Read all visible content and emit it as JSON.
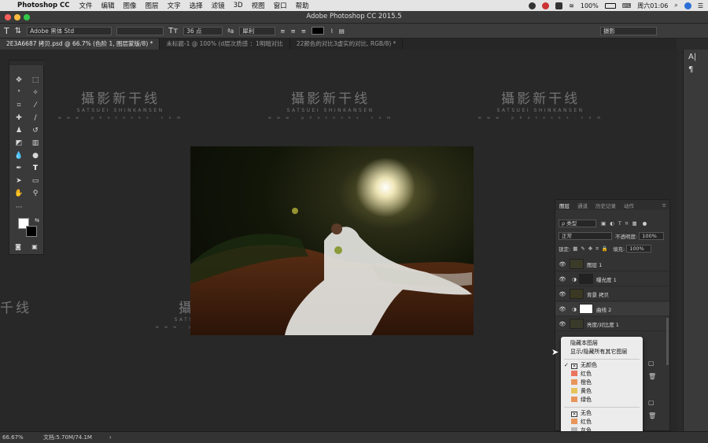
{
  "menubar": {
    "app": "Photoshop CC",
    "items": [
      "文件",
      "编辑",
      "图像",
      "图层",
      "文字",
      "选择",
      "滤镜",
      "3D",
      "视图",
      "窗口",
      "帮助"
    ],
    "battery": "100%",
    "clock": "周六01:06"
  },
  "window": {
    "title": "Adobe Photoshop CC 2015.5"
  },
  "options": {
    "font_family": "Adobe 黑体 Std",
    "font_size": "36 点",
    "antialias": "犀利",
    "workspace": "摄影"
  },
  "tabs": [
    {
      "label": "2E3A6687 拷贝.psd @ 66.7% (色阶 1, 图层蒙版/8) *"
    },
    {
      "label": "未标题-1 @ 100% (d层次质感 ：1明暗对比"
    },
    {
      "label": "22颜色的对比3虚实的对比, RGB/8) *"
    }
  ],
  "watermark": {
    "title": "攝影新干线",
    "subtitle": "SATSUEI SHINKANSEN",
    "url": "w w w . p h o t o s k s . c o m",
    "short_title": "千线"
  },
  "right_column": {
    "char_icon": "A|",
    "para_icon": "¶"
  },
  "layers_panel": {
    "tabs": [
      "图层",
      "通道",
      "历史记录",
      "动作"
    ],
    "kind_filter": "ρ 类型",
    "blend_mode": "正常",
    "opacity_label": "不透明度:",
    "opacity_value": "100%",
    "lock_label": "锁定:",
    "fill_label": "填充:",
    "fill_value": "100%",
    "layers": [
      {
        "name": "图层 1"
      },
      {
        "name": "曝光度 1"
      },
      {
        "name": "背景 拷贝"
      },
      {
        "name": "曲线 2"
      },
      {
        "name": "亮度/对比度 1"
      }
    ]
  },
  "context_menu": {
    "items": [
      "隐藏本图层",
      "显示/隐藏所有其它图层"
    ],
    "colors": [
      {
        "label": "无颜色",
        "hex": "#ffffff",
        "checked": true
      },
      {
        "label": "红色",
        "hex": "#e8765e"
      },
      {
        "label": "橙色",
        "hex": "#e8955a"
      },
      {
        "label": "黄色",
        "hex": "#e6c35b"
      },
      {
        "label": "绿色",
        "hex": "#e8955a"
      }
    ],
    "colors2": [
      {
        "label": "无色",
        "hex": "#ffffff"
      },
      {
        "label": "红色",
        "hex": "#e8955a"
      },
      {
        "label": "灰色",
        "hex": "#b4b4b4"
      }
    ]
  },
  "status": {
    "zoom": "66.67%",
    "doc": "文档:5.70M/74.1M"
  }
}
